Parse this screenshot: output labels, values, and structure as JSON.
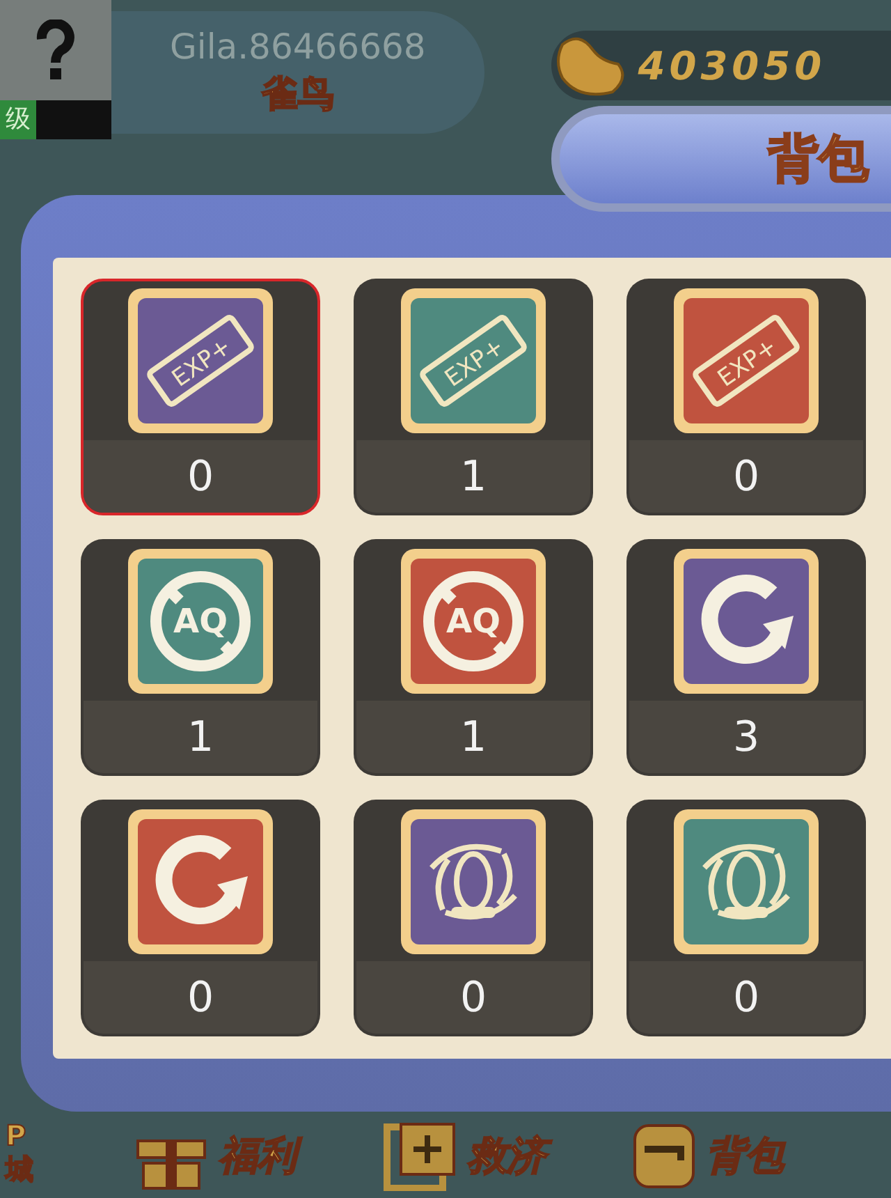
{
  "player": {
    "level_label": "级",
    "account": "Gila.86466668",
    "nickname": "雀鸟"
  },
  "coins": {
    "amount": "403050"
  },
  "panel": {
    "title": "背包"
  },
  "items": [
    {
      "kind": "exp",
      "icon_text": "EXP+",
      "color": "#6b5a94",
      "count": "0",
      "selected": true
    },
    {
      "kind": "exp",
      "icon_text": "EXP+",
      "color": "#4f8a7f",
      "count": "1",
      "selected": false
    },
    {
      "kind": "exp",
      "icon_text": "EXP+",
      "color": "#c0533f",
      "count": "0",
      "selected": false
    },
    {
      "kind": "no-aq",
      "icon_text": "AQ",
      "color": "#4f8a7f",
      "count": "1",
      "selected": false
    },
    {
      "kind": "no-aq",
      "icon_text": "AQ",
      "color": "#c0533f",
      "count": "1",
      "selected": false
    },
    {
      "kind": "refresh",
      "color": "#6b5a94",
      "count": "3",
      "selected": false
    },
    {
      "kind": "refresh",
      "color": "#c0533f",
      "count": "0",
      "selected": false
    },
    {
      "kind": "vortex",
      "color": "#6b5a94",
      "count": "0",
      "selected": false
    },
    {
      "kind": "vortex",
      "color": "#4f8a7f",
      "count": "0",
      "selected": false
    }
  ],
  "bottom_nav": {
    "edge_top": "P",
    "edge_bottom": "城",
    "items": [
      {
        "kind": "gift",
        "label": "福利"
      },
      {
        "kind": "relief",
        "label": "救济"
      },
      {
        "kind": "bag",
        "label": "背包"
      }
    ]
  }
}
